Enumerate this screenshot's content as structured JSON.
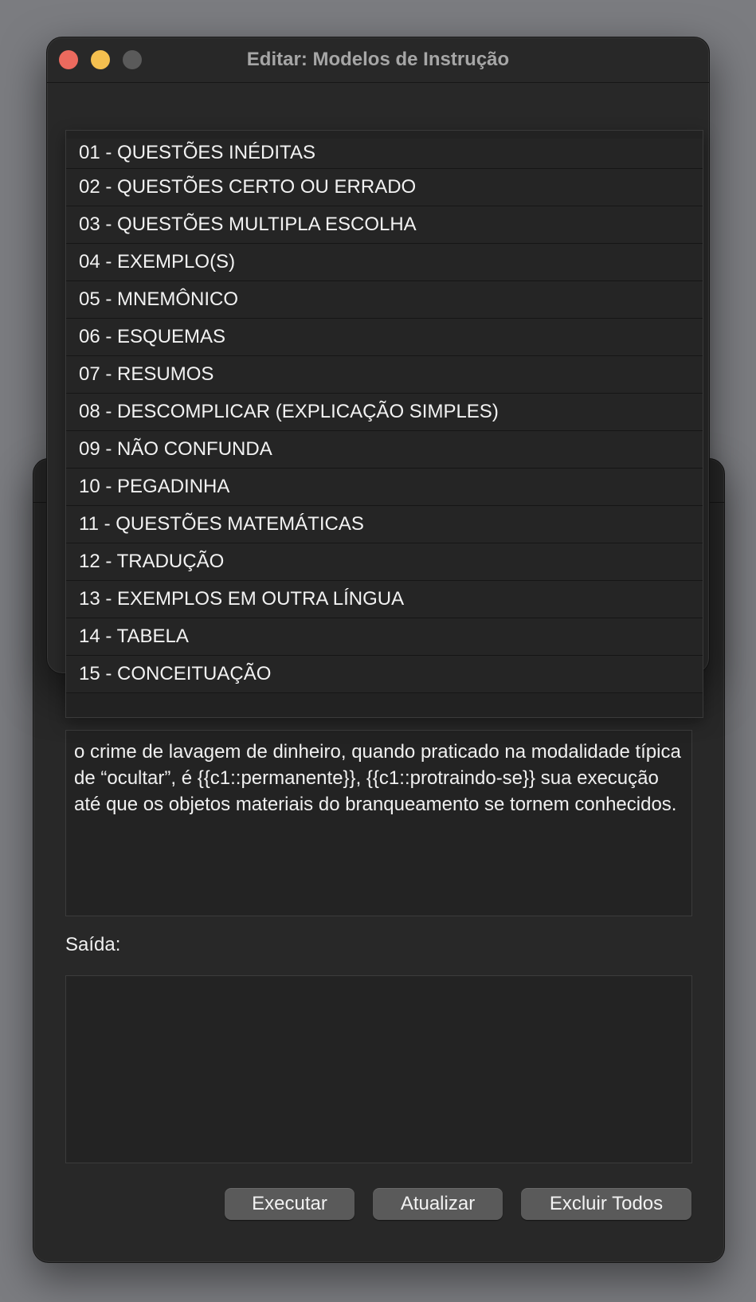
{
  "front_window": {
    "title": "Editar: Modelos de Instrução"
  },
  "templates": {
    "items": [
      {
        "label": "01 - QUESTÕES INÉDITAS"
      },
      {
        "label": "02 - QUESTÕES CERTO OU ERRADO"
      },
      {
        "label": "03 - QUESTÕES MULTIPLA ESCOLHA"
      },
      {
        "label": "04 - EXEMPLO(S)"
      },
      {
        "label": "05 - MNEMÔNICO"
      },
      {
        "label": "06 - ESQUEMAS"
      },
      {
        "label": "07 - RESUMOS"
      },
      {
        "label": "08 - DESCOMPLICAR (EXPLICAÇÃO SIMPLES)"
      },
      {
        "label": "09 - NÃO CONFUNDA"
      },
      {
        "label": "10 - PEGADINHA"
      },
      {
        "label": "11 - QUESTÕES MATEMÁTICAS"
      },
      {
        "label": "12 - TRADUÇÃO"
      },
      {
        "label": "13 - EXEMPLOS EM OUTRA LÍNGUA"
      },
      {
        "label": "14 - TABELA"
      },
      {
        "label": "15 - CONCEITUAÇÃO"
      }
    ]
  },
  "editor": {
    "input_text": "o crime de lavagem de dinheiro, quando praticado na modalidade típica de “ocultar”, é {{c1::permanente}}, {{c1::protraindo-se}} sua execução até que os objetos materiais do branqueamento se tornem conhecidos.",
    "output_label": "Saída:",
    "output_text": ""
  },
  "buttons": {
    "run": "Executar",
    "update": "Atualizar",
    "delete_all": "Excluir Todos"
  },
  "colors": {
    "close": "#ec6a5e",
    "minimize": "#f4bf4f",
    "zoom_inactive": "#5a5a5a",
    "window_bg": "#282828",
    "desktop_bg": "#7b7c80"
  }
}
